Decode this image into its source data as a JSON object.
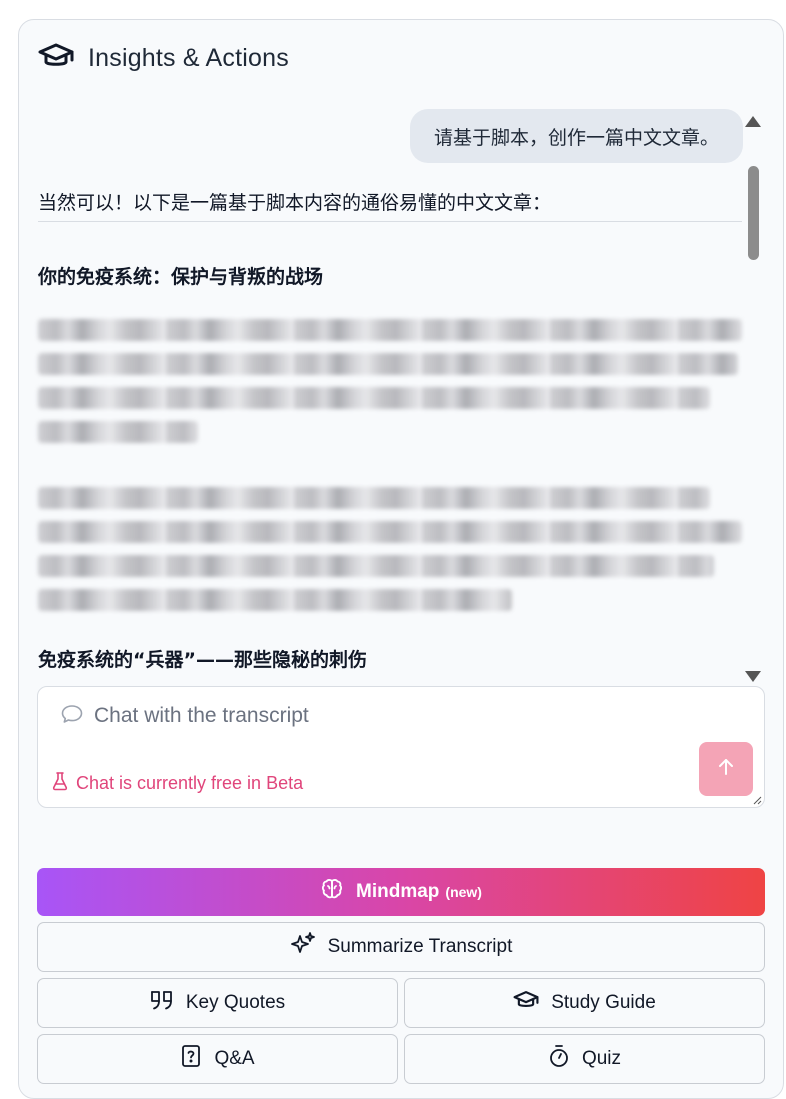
{
  "header": {
    "title": "Insights & Actions",
    "icon": "graduation-cap-icon"
  },
  "chat": {
    "user_message": "请基于脚本，创作一篇中文文章。",
    "assistant_intro": "当然可以！以下是一篇基于脚本内容的通俗易懂的中文文章：",
    "assistant_heading": "你的免疫系统：保护与背叛的战场",
    "assistant_heading_next": "免疫系统的“兵器”——那些隐秘的刺伤"
  },
  "input": {
    "placeholder": "Chat with the transcript",
    "beta_notice": "Chat is currently free in Beta"
  },
  "actions": {
    "mindmap_label": "Mindmap",
    "mindmap_badge": "(new)",
    "summarize_label": "Summarize Transcript",
    "quotes_label": "Key Quotes",
    "study_label": "Study Guide",
    "qa_label": "Q&A",
    "quiz_label": "Quiz"
  },
  "colors": {
    "mindmap_gradient_start": "#a855f7",
    "mindmap_gradient_end": "#ef4444",
    "send_button": "#f4a4b6",
    "beta_text": "#e0457b"
  }
}
